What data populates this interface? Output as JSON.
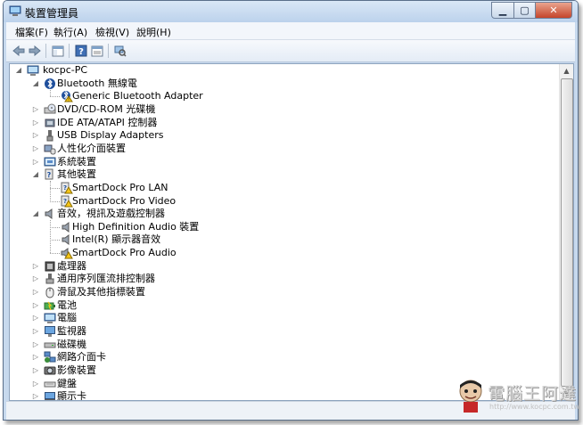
{
  "window": {
    "title": "裝置管理員"
  },
  "menu": [
    {
      "label": "檔案(F)"
    },
    {
      "label": "執行(A)"
    },
    {
      "label": "檢視(V)"
    },
    {
      "label": "說明(H)"
    }
  ],
  "toolbar": {
    "buttons": [
      {
        "name": "back-arrow-icon"
      },
      {
        "name": "forward-arrow-icon"
      },
      {
        "name": "show-hide-console-tree-icon"
      },
      {
        "name": "help-icon"
      },
      {
        "name": "properties-icon"
      },
      {
        "name": "scan-hardware-icon"
      }
    ]
  },
  "tree": [
    {
      "label": "kocpc-PC",
      "level": 0,
      "state": "expanded",
      "icon": "computer-icon"
    },
    {
      "label": "Bluetooth 無線電",
      "level": 1,
      "state": "expanded",
      "icon": "bluetooth-icon"
    },
    {
      "label": "Generic Bluetooth Adapter",
      "level": 2,
      "state": "leaf",
      "icon": "bluetooth-warning-icon"
    },
    {
      "label": "DVD/CD-ROM 光碟機",
      "level": 1,
      "state": "collapsed",
      "icon": "dvd-drive-icon"
    },
    {
      "label": "IDE ATA/ATAPI 控制器",
      "level": 1,
      "state": "collapsed",
      "icon": "ide-controller-icon"
    },
    {
      "label": "USB Display Adapters",
      "level": 1,
      "state": "collapsed",
      "icon": "usb-display-icon"
    },
    {
      "label": "人性化介面裝置",
      "level": 1,
      "state": "collapsed",
      "icon": "hid-icon"
    },
    {
      "label": "系統裝置",
      "level": 1,
      "state": "collapsed",
      "icon": "system-devices-icon"
    },
    {
      "label": "其他裝置",
      "level": 1,
      "state": "expanded",
      "icon": "other-devices-icon"
    },
    {
      "label": "SmartDock Pro LAN",
      "level": 2,
      "state": "leaf",
      "icon": "unknown-device-warning-icon"
    },
    {
      "label": "SmartDock Pro Video",
      "level": 2,
      "state": "leaf",
      "icon": "unknown-device-warning-icon"
    },
    {
      "label": "音效，視訊及遊戲控制器",
      "level": 1,
      "state": "expanded",
      "icon": "speaker-icon"
    },
    {
      "label": "High Definition Audio 裝置",
      "level": 2,
      "state": "leaf",
      "icon": "speaker-icon"
    },
    {
      "label": "Intel(R) 顯示器音效",
      "level": 2,
      "state": "leaf",
      "icon": "speaker-icon"
    },
    {
      "label": "SmartDock Pro Audio",
      "level": 2,
      "state": "leaf",
      "icon": "speaker-warning-icon"
    },
    {
      "label": "處理器",
      "level": 1,
      "state": "collapsed",
      "icon": "processor-icon"
    },
    {
      "label": "通用序列匯流排控制器",
      "level": 1,
      "state": "collapsed",
      "icon": "usb-controller-icon"
    },
    {
      "label": "滑鼠及其他指標裝置",
      "level": 1,
      "state": "collapsed",
      "icon": "mouse-icon"
    },
    {
      "label": "電池",
      "level": 1,
      "state": "collapsed",
      "icon": "battery-icon"
    },
    {
      "label": "電腦",
      "level": 1,
      "state": "collapsed",
      "icon": "computer-icon"
    },
    {
      "label": "監視器",
      "level": 1,
      "state": "collapsed",
      "icon": "monitor-icon"
    },
    {
      "label": "磁碟機",
      "level": 1,
      "state": "collapsed",
      "icon": "disk-drive-icon"
    },
    {
      "label": "網路介面卡",
      "level": 1,
      "state": "collapsed",
      "icon": "network-adapter-icon"
    },
    {
      "label": "影像裝置",
      "level": 1,
      "state": "collapsed",
      "icon": "imaging-device-icon"
    },
    {
      "label": "鍵盤",
      "level": 1,
      "state": "collapsed",
      "icon": "keyboard-icon"
    },
    {
      "label": "顯示卡",
      "level": 1,
      "state": "collapsed",
      "icon": "display-adapter-icon"
    }
  ],
  "watermark": {
    "text": "電腦王阿達",
    "url": "http://www.kocpc.com.tw"
  }
}
